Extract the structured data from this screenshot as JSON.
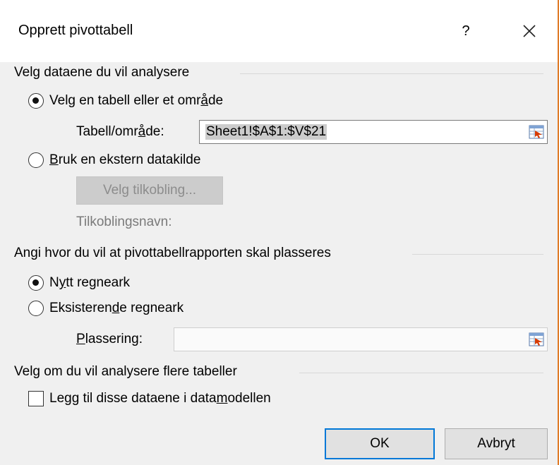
{
  "window": {
    "title": "Opprett pivottabell",
    "help_label": "?",
    "close_icon": "close-icon"
  },
  "data_source": {
    "group_label": "Velg dataene du vil analysere",
    "option_table_pre": "Velg en tabell eller et omr",
    "option_table_key": "å",
    "option_table_post": "de",
    "table_range_pre": "Tabell/omr",
    "table_range_key": "å",
    "table_range_post": "de:",
    "table_range_value": "Sheet1!$A$1:$V$21",
    "option_external_key": "B",
    "option_external_post": "ruk en ekstern datakilde",
    "choose_connection_label": "Velg tilkobling...",
    "connection_name_label": "Tilkoblingsnavn:",
    "selected": "table"
  },
  "placement": {
    "group_label": "Angi hvor du vil at pivottabellrapporten skal plasseres",
    "option_new_pre": "N",
    "option_new_key": "y",
    "option_new_post": "tt regneark",
    "option_existing_pre": "Eksisteren",
    "option_existing_key": "d",
    "option_existing_post": "e regneark",
    "location_key": "P",
    "location_post": "lassering:",
    "location_value": "",
    "selected": "new"
  },
  "multiple_tables": {
    "group_label": "Velg om du vil analysere flere tabeller",
    "checkbox_pre": "Legg til disse dataene i data",
    "checkbox_key": "m",
    "checkbox_post": "odellen",
    "checked": false
  },
  "buttons": {
    "ok_label": "OK",
    "cancel_label": "Avbryt"
  }
}
